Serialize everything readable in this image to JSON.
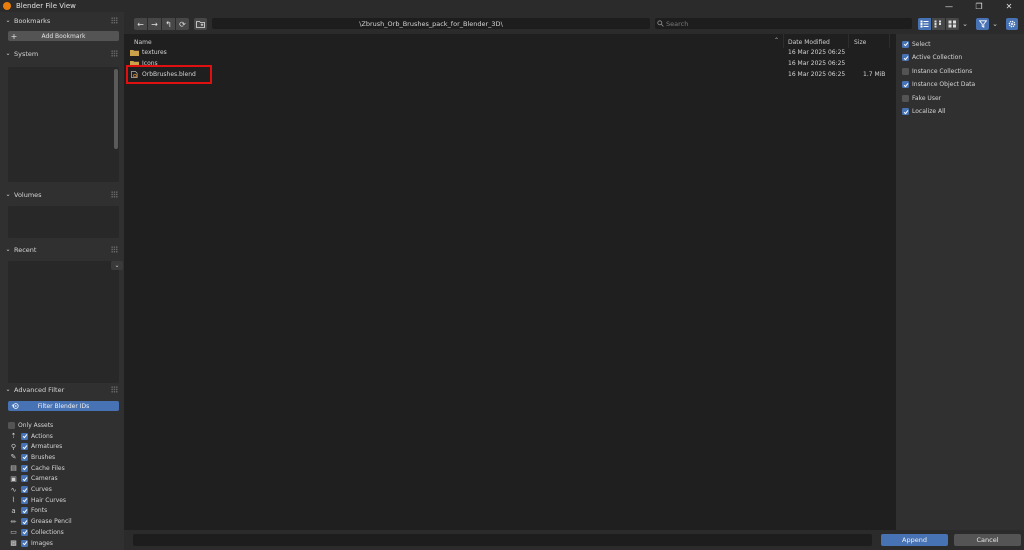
{
  "window": {
    "title": "Blender File View",
    "minimize_glyph": "—",
    "maximize_glyph": "❐",
    "close_glyph": "✕"
  },
  "sidebar": {
    "bookmarks": {
      "label": "Bookmarks",
      "add_label": "Add Bookmark"
    },
    "system": {
      "label": "System"
    },
    "volumes": {
      "label": "Volumes"
    },
    "recent": {
      "label": "Recent"
    },
    "advanced_filter": {
      "label": "Advanced Filter",
      "filter_button": "Filter Blender IDs",
      "only_assets": {
        "label": "Only Assets",
        "checked": false
      },
      "items": [
        {
          "label": "Actions",
          "checked": true,
          "icon": "action-icon"
        },
        {
          "label": "Armatures",
          "checked": true,
          "icon": "armature-icon"
        },
        {
          "label": "Brushes",
          "checked": true,
          "icon": "brush-icon"
        },
        {
          "label": "Cache Files",
          "checked": true,
          "icon": "cache-file-icon"
        },
        {
          "label": "Cameras",
          "checked": true,
          "icon": "camera-icon"
        },
        {
          "label": "Curves",
          "checked": true,
          "icon": "curve-icon"
        },
        {
          "label": "Hair Curves",
          "checked": true,
          "icon": "hair-curve-icon"
        },
        {
          "label": "Fonts",
          "checked": true,
          "icon": "font-icon"
        },
        {
          "label": "Grease Pencil",
          "checked": true,
          "icon": "grease-pencil-icon"
        },
        {
          "label": "Collections",
          "checked": true,
          "icon": "collection-icon"
        },
        {
          "label": "Images",
          "checked": true,
          "icon": "image-icon"
        }
      ]
    }
  },
  "toolbar": {
    "back_glyph": "←",
    "forward_glyph": "→",
    "parent_glyph": "↰",
    "refresh_glyph": "⟳",
    "path": "\\Zbrush_Orb_Brushes_pack_for_Blender_3D\\",
    "search_placeholder": "Search"
  },
  "filelist": {
    "columns": {
      "name": "Name",
      "date": "Date Modified",
      "size": "Size"
    },
    "rows": [
      {
        "name": "textures",
        "date": "16 Mar 2025 06:25",
        "size": "",
        "type": "folder"
      },
      {
        "name": "Icons",
        "date": "16 Mar 2025 06:25",
        "size": "",
        "type": "folder"
      },
      {
        "name": "OrbBrushes.blend",
        "date": "16 Mar 2025 06:25",
        "size": "1.7 MiB",
        "type": "blend"
      }
    ]
  },
  "options": [
    {
      "label": "Select",
      "checked": true
    },
    {
      "label": "Active Collection",
      "checked": true
    },
    {
      "label": "Instance Collections",
      "checked": false
    },
    {
      "label": "Instance Object Data",
      "checked": true
    },
    {
      "label": "Fake User",
      "checked": false
    },
    {
      "label": "Localize All",
      "checked": true
    }
  ],
  "bottom": {
    "filename_value": "",
    "append_label": "Append",
    "cancel_label": "Cancel"
  },
  "colors": {
    "accent": "#4772b3",
    "highlight_box": "#e01010",
    "folder": "#c9a24a"
  }
}
